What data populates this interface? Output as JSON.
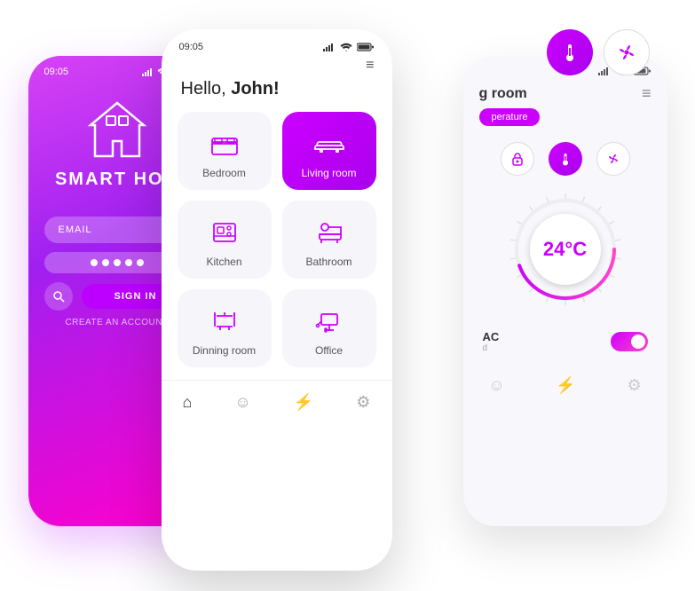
{
  "left_phone": {
    "time": "09:05",
    "title": "SMART HON",
    "email_placeholder": "EMAIL",
    "sign_in": "SIGN IN",
    "create_account": "CREATE AN ACCOUNT"
  },
  "mid_phone": {
    "time": "09:05",
    "greeting": "Hello, ",
    "name": "John!",
    "rooms": [
      {
        "id": "bedroom",
        "label": "Bedroom",
        "active": false
      },
      {
        "id": "living",
        "label": "Living room",
        "active": true
      },
      {
        "id": "kitchen",
        "label": "Kitchen",
        "active": false
      },
      {
        "id": "bathroom",
        "label": "Bathroom",
        "active": false
      },
      {
        "id": "dinning",
        "label": "Dinning room",
        "active": false
      },
      {
        "id": "office",
        "label": "Office",
        "active": false
      }
    ]
  },
  "right_phone": {
    "room_title": "g room",
    "temp_badge": "perature",
    "temperature": "24°C",
    "ac_label": "AC",
    "ac_status": "d"
  },
  "float_icons": {
    "thermometer": "🌡",
    "fan": "⚡"
  }
}
